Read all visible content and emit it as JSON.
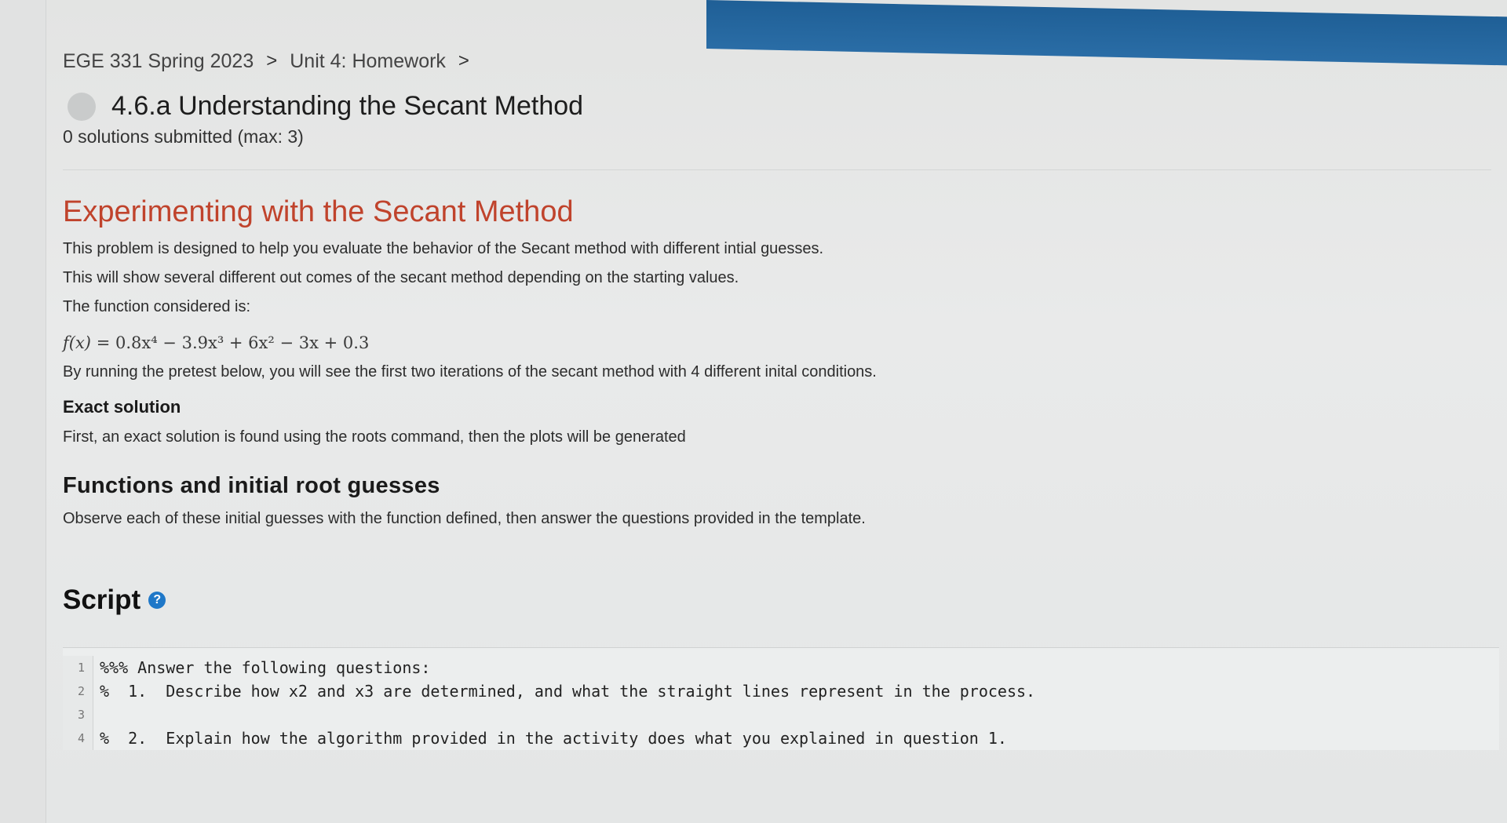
{
  "breadcrumb": {
    "course": "EGE 331 Spring 2023",
    "unit": "Unit 4: Homework",
    "sep1": ">",
    "sep2": ">"
  },
  "problem": {
    "title": "4.6.a Understanding the Secant Method",
    "submissions": "0 solutions submitted (max: 3)"
  },
  "description": {
    "heading": "Experimenting with the Secant Method",
    "p1": "This problem is designed to help you evaluate the behavior of the Secant method with different intial guesses.",
    "p2": "This will show several different out comes of the secant method depending on the starting values.",
    "p3": "The function considered is:",
    "equation": {
      "lhs": "f(x)",
      "rhs": "= 0.8x⁴ − 3.9x³ + 6x² − 3x + 0.3"
    },
    "p4": "By running the pretest below, you will see the first two iterations of the secant method with 4 different inital conditions.",
    "exact_heading": "Exact solution",
    "p5": "First, an exact solution is  found using the roots command, then the plots will be generated",
    "functions_heading": "Functions and initial root guesses",
    "p6": "Observe each of these initial guesses with the function defined, then answer the questions provided in the template."
  },
  "script": {
    "title": "Script",
    "help_icon": "?",
    "lines": [
      {
        "num": "1",
        "text": "%%% Answer the following questions:"
      },
      {
        "num": "2",
        "text": "%  1.  Describe how x2 and x3 are determined, and what the straight lines represent in the process."
      },
      {
        "num": "3",
        "text": ""
      },
      {
        "num": "4",
        "text": "%  2.  Explain how the algorithm provided in the activity does what you explained in question 1."
      }
    ]
  },
  "colors": {
    "heading_accent": "#c0432c",
    "help_icon": "#1f78c8",
    "top_bar": "#1f5f96"
  }
}
